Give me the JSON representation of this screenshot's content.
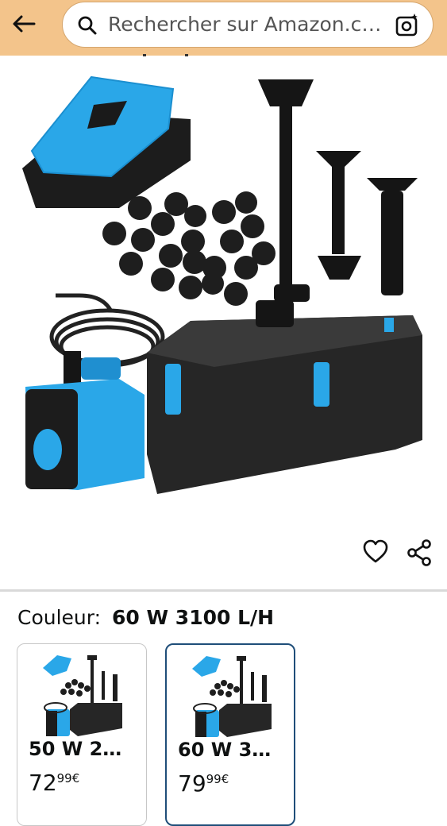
{
  "search": {
    "placeholder": "Rechercher sur Amazon.c…"
  },
  "colors": {
    "topbar": "#f3c48b",
    "selected_border": "#1f4e79",
    "accent_blue": "#2aa7e8"
  },
  "product": {
    "color_label": "Couleur:",
    "color_value": "60 W 3100 L/H"
  },
  "variants": [
    {
      "title": "50 W 2…",
      "price_whole": "72",
      "price_fraction": "99",
      "currency": "€",
      "selected": false
    },
    {
      "title": "60 W 3…",
      "price_whole": "79",
      "price_fraction": "99",
      "currency": "€",
      "selected": true
    }
  ],
  "icons": {
    "back": "back-arrow-icon",
    "search": "search-icon",
    "lens": "camera-lens-icon",
    "wishlist": "heart-icon",
    "share": "share-icon"
  }
}
